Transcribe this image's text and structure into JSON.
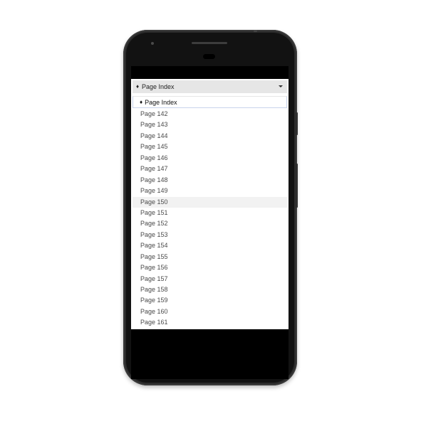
{
  "select": {
    "icon": "diamond-icon",
    "selected_label": "Page Index"
  },
  "dropdown": {
    "header_icon": "diamond-icon",
    "header_label": "Page Index",
    "options": [
      "Page 142",
      "Page 143",
      "Page 144",
      "Page 145",
      "Page 146",
      "Page 147",
      "Page 148",
      "Page 149",
      "Page 150",
      "Page 151",
      "Page 152",
      "Page 153",
      "Page 154",
      "Page 155",
      "Page 156",
      "Page 157",
      "Page 158",
      "Page 159",
      "Page 160",
      "Page 161"
    ],
    "highlighted_option": "Page 150"
  },
  "colors": {
    "phone_body": "#2b2b2b",
    "screen_background": "#000000",
    "select_background": "#e6e6e6",
    "highlight_row": "#f2f2f2",
    "header_border": "#c9d4ec"
  }
}
